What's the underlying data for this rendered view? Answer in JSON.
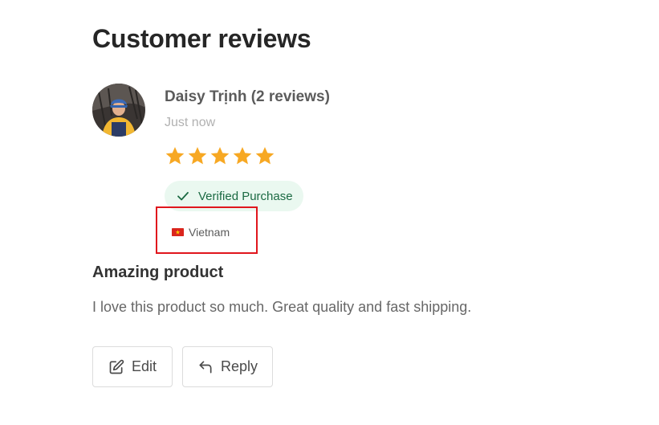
{
  "section": {
    "title": "Customer reviews"
  },
  "review": {
    "reviewer_name": "Daisy Trịnh (2 reviews)",
    "time": "Just now",
    "rating": 5,
    "rating_max": 5,
    "verified_label": "Verified Purchase",
    "country": "Vietnam",
    "title": "Amazing product",
    "body": "I love this product so much. Great quality and fast shipping."
  },
  "actions": {
    "edit_label": "Edit",
    "reply_label": "Reply"
  },
  "icons": {
    "avatar": "reviewer-avatar",
    "star": "star-icon",
    "verified": "check-icon",
    "flag": "vietnam-flag-icon",
    "edit": "edit-icon",
    "reply": "reply-icon"
  },
  "colors": {
    "star": "#F7A823",
    "verified_bg": "#EAF8F0",
    "verified_text": "#1B6A43",
    "highlight": "#E0161D",
    "flag_red": "#DA251D",
    "flag_star": "#FFCD00"
  }
}
